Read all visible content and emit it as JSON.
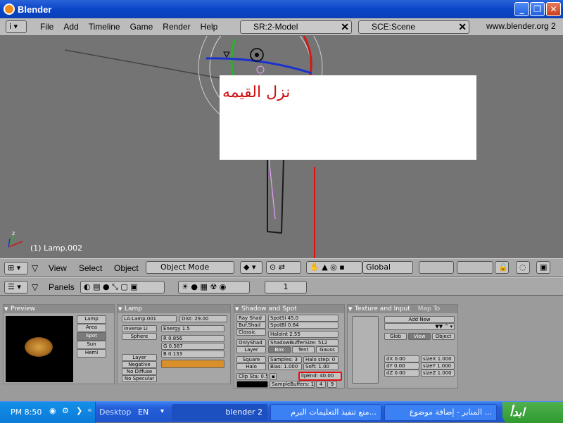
{
  "window": {
    "title": "Blender"
  },
  "menu": {
    "items": [
      "File",
      "Add",
      "Timeline",
      "Game",
      "Render",
      "Help"
    ],
    "screen_select": "SR:2-Model",
    "scene_select": "SCE:Scene",
    "website": "www.blender.org 2"
  },
  "viewport": {
    "object_label": "(1) Lamp.002",
    "note_text": "نزل القيمه"
  },
  "viewport_header": {
    "view": "View",
    "select": "Select",
    "object": "Object",
    "mode": "Object Mode",
    "orientation": "Global"
  },
  "buttons_header": {
    "panels": "Panels",
    "frame": "1"
  },
  "preview": {
    "title": "Preview",
    "types": [
      "Lamp",
      "Area",
      "Spot",
      "Sun",
      "Hemi"
    ]
  },
  "lamp": {
    "title": "Lamp",
    "name": "LA:Lamp.001",
    "dist": "Dist: 29.00",
    "inverse": "Inverse Li",
    "sphere": "Sphere",
    "energy": "Energy 1.5",
    "r": "R 0.856",
    "g": "G 0.567",
    "bb": "B 0.133",
    "layer": "Layer",
    "negative": "Negative",
    "no_diffuse": "No Diffuse",
    "no_specular": "No Specular",
    "color_hex": "#d9902a"
  },
  "shadow": {
    "title": "Shadow and Spot",
    "ray_shad": "Ray Shad",
    "buf_shad": "Buf.Shad",
    "classic": "Classic",
    "spot_si": "SpotSi 45.0",
    "spot_bl": "SpotBl 0.64",
    "halo_int": "HaloInt 2.55",
    "only_shad": "OnlyShad",
    "layer": "Layer",
    "shadow_buffer_size": "ShadowBufferSize: 512",
    "box": "Box",
    "tent": "Tent",
    "gauss": "Gauss",
    "square": "Square",
    "halo": "Halo",
    "samples": "Samples: 3",
    "halo_step": "Halo step: 0",
    "bias": "Bias: 1.000",
    "soft": "Soft: 1.00",
    "clip_sta": "Clip Sta: 0.50",
    "clip_end": "lipEnd: 40.00",
    "sample_buffers": "SampleBuffers: 1",
    "buf4": "4",
    "buf9": "9"
  },
  "texture": {
    "title": "Texture and Input",
    "map_to": "Map To",
    "add_new": "Add New",
    "glob": "Glob",
    "view": "View",
    "object": "Object",
    "dx": "dX 0.00",
    "dy": "dY 0.00",
    "dz": "dZ 0.00",
    "sx": "sizeX 1.000",
    "sy": "sizeY 1.000",
    "sz": "sizeZ 1.000"
  },
  "taskbar": {
    "time": "PM 8:50",
    "desktop": "Desktop",
    "lang": "EN",
    "tasks": [
      "blender 2",
      "منع تنفيذ التعليمات البرم...",
      "المنابر - إضافة موضوع ..."
    ],
    "start": "ابدأ"
  },
  "colors": {
    "annotation_red": "#e01010",
    "titlebar_blue": "#0a46c8"
  }
}
